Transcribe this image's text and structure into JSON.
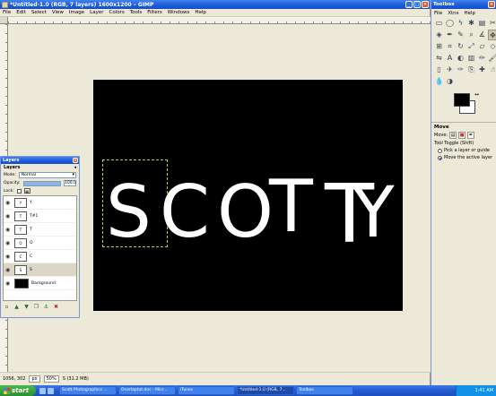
{
  "main_window": {
    "title": "*Untitled-1.0 (RGB, 7 layers) 1600x1200 – GIMP",
    "menu": [
      "File",
      "Edit",
      "Select",
      "View",
      "Image",
      "Layer",
      "Colors",
      "Tools",
      "Filters",
      "Windows",
      "Help"
    ]
  },
  "canvas": {
    "letters": [
      "S",
      "C",
      "O",
      "T",
      "T",
      "Y"
    ]
  },
  "statusbar": {
    "coords": "1056, 302",
    "unit": "px",
    "zoom": "50%",
    "info": "S (31.2 MB)"
  },
  "layers_dialog": {
    "title": "Layers",
    "header": "Layers",
    "mode_label": "Mode:",
    "mode_value": "Normal",
    "opacity_label": "Opacity:",
    "opacity_value": "100.0",
    "opacity_fraction": 1.0,
    "lock_label": "Lock:",
    "layers": [
      {
        "name": "Y",
        "thumb": "Y"
      },
      {
        "name": "T#1",
        "thumb": "T"
      },
      {
        "name": "T",
        "thumb": "T"
      },
      {
        "name": "O",
        "thumb": "O"
      },
      {
        "name": "C",
        "thumb": "C"
      },
      {
        "name": "S",
        "thumb": "S",
        "selected": true
      },
      {
        "name": "Background",
        "thumb": ""
      }
    ]
  },
  "toolbox": {
    "title": "Toolbox",
    "menu": [
      "File",
      "Xtns",
      "Help"
    ],
    "tool_options": {
      "header": "Move",
      "move_label": "Move:",
      "toggle_label": "Tool Toggle (Shift)",
      "options": [
        {
          "label": "Pick a layer or guide",
          "selected": false
        },
        {
          "label": "Move the active layer",
          "selected": true
        }
      ]
    }
  },
  "taskbar": {
    "start_label": "start",
    "tasks": [
      {
        "label": "Scott Photographics ...",
        "active": false
      },
      {
        "label": "Overlaptut.doc - Micr...",
        "active": false
      },
      {
        "label": "iTunes",
        "active": false
      },
      {
        "label": "*Untitled-1.0 (RGB, 7...",
        "active": true
      },
      {
        "label": "Toolbox",
        "active": false
      }
    ],
    "clock": "1:41 AM"
  }
}
